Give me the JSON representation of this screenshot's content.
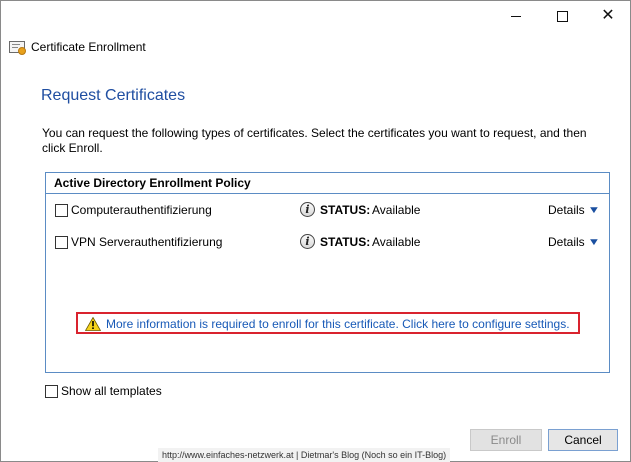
{
  "window": {
    "app_title": "Certificate Enrollment",
    "controls": {
      "minimize": "minimize",
      "maximize": "maximize",
      "close": "close"
    }
  },
  "page": {
    "title": "Request Certificates",
    "intro": "You can request the following types of certificates. Select the certificates you want to request, and then click Enroll."
  },
  "policy": {
    "header": "Active Directory Enrollment Policy",
    "items": [
      {
        "name": "Computerauthentifizierung",
        "checked": false,
        "status_label": "STATUS:",
        "status": "Available",
        "details": "Details"
      },
      {
        "name": "VPN Serverauthentifizierung",
        "checked": false,
        "status_label": "STATUS:",
        "status": "Available",
        "details": "Details"
      }
    ],
    "warning": "More information is required to enroll for this certificate. Click here to configure settings."
  },
  "options": {
    "show_all_templates": "Show all templates",
    "show_all_checked": false
  },
  "footer": {
    "watermark": "http://www.einfaches-netzwerk.at | Dietmar's Blog (Noch so ein IT-Blog)",
    "enroll_label": "Enroll",
    "enroll_enabled": false,
    "cancel_label": "Cancel"
  },
  "icons": {
    "app": "certificate-icon",
    "status": "info-icon",
    "warning": "warning-icon",
    "details": "chevron-down-icon"
  },
  "colors": {
    "title_blue": "#1f4ea1",
    "link_blue": "#1759b7",
    "box_border": "#5b8cc4",
    "highlight_red": "#d9232e"
  }
}
